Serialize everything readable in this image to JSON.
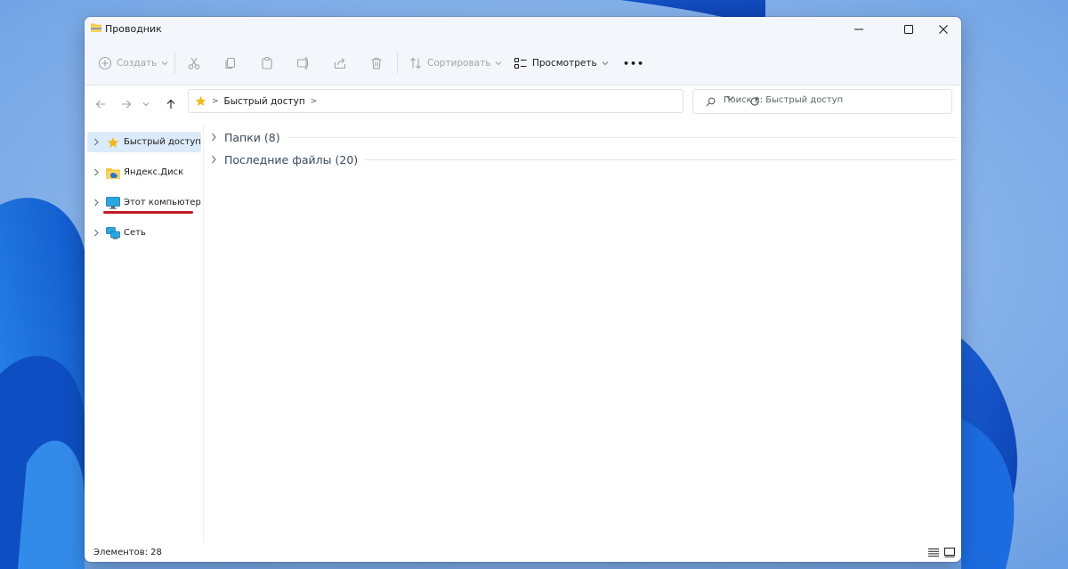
{
  "window": {
    "title": "Проводник"
  },
  "toolbar": {
    "create_label": "Создать",
    "sort_label": "Сортировать",
    "view_label": "Просмотреть",
    "more_label": "•••"
  },
  "address": {
    "separator": ">",
    "location": "Быстрый доступ"
  },
  "search": {
    "placeholder": "Поиск в: Быстрый доступ"
  },
  "sidebar": {
    "items": [
      {
        "label": "Быстрый доступ",
        "icon": "star-icon"
      },
      {
        "label": "Яндекс.Диск",
        "icon": "cloud-folder-icon"
      },
      {
        "label": "Этот компьютер",
        "icon": "monitor-icon"
      },
      {
        "label": "Сеть",
        "icon": "network-icon"
      }
    ]
  },
  "content": {
    "groups": [
      {
        "label": "Папки (8)"
      },
      {
        "label": "Последние файлы (20)"
      }
    ]
  },
  "status": {
    "items_count": "Элементов: 28"
  },
  "colors": {
    "accent_selection": "#dcebfb",
    "annotation_underline": "#c01c28",
    "star": "#f2b61d",
    "folder": "#f4c542"
  }
}
